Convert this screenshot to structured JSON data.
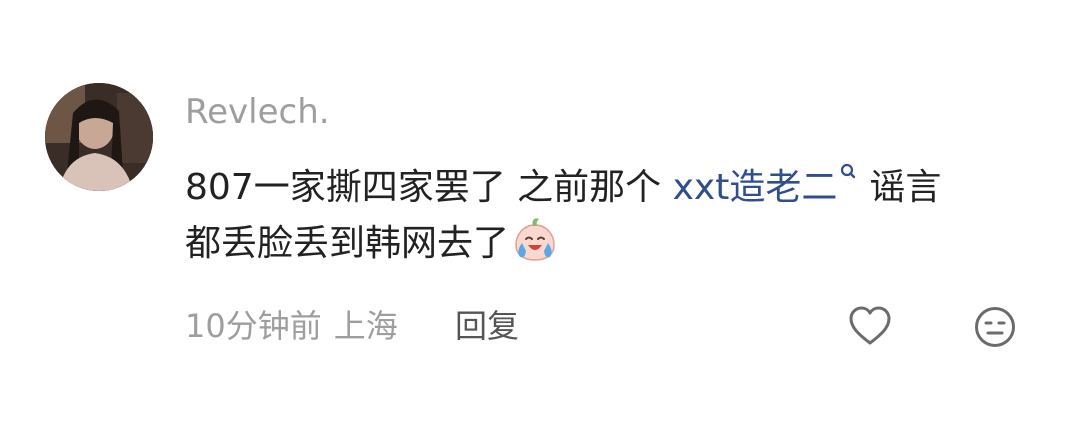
{
  "comment": {
    "username": "Revlech.",
    "text_line1_before": "807一家撕四家罢了 之前那个 ",
    "topic_link": "xxt造老二",
    "text_line1_after": "谣言",
    "text_line2": "都丢脸丢到韩网去了",
    "emoji": "crying-laughing-peach-emoji",
    "time": "10分钟前",
    "location": "上海",
    "reply_label": "回复",
    "icons": {
      "like": "heart-icon",
      "react": "face-icon",
      "link": "search-icon"
    },
    "colors": {
      "username": "#9e9e9e",
      "text": "#222222",
      "link": "#2f4f8c",
      "meta": "#9e9e9e"
    }
  }
}
